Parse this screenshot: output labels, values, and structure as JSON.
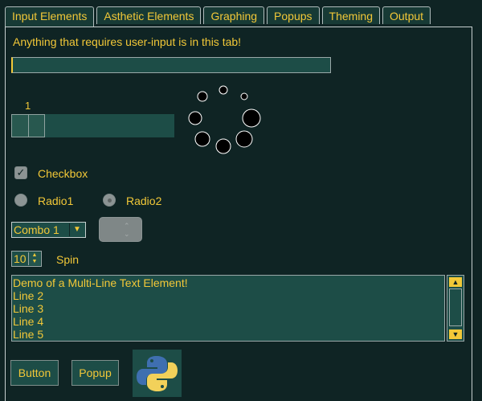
{
  "tabs": [
    "Input Elements",
    "Asthetic Elements",
    "Graphing",
    "Popups",
    "Theming",
    "Output"
  ],
  "active_tab": "Input Elements",
  "caption": "Anything that requires user-input is in this tab!",
  "input": {
    "value": ""
  },
  "slider": {
    "value_label": "1",
    "value": 1
  },
  "spinner": {
    "state": "loading",
    "icon": "loading-spinner-icon"
  },
  "checkbox": {
    "label": "Checkbox",
    "checked": true
  },
  "radios": [
    {
      "label": "Radio1",
      "selected": false
    },
    {
      "label": "Radio2",
      "selected": true
    }
  ],
  "combo": {
    "value": "Combo 1",
    "icon": "chevron-down-icon"
  },
  "combo2": {
    "value": "",
    "icon": "up-down-arrows-icon"
  },
  "spin": {
    "value": "10",
    "label": "Spin"
  },
  "multiline": {
    "lines": [
      "Demo of a Multi-Line Text Element!",
      "Line 2",
      "Line 3",
      "Line 4",
      "Line 5"
    ]
  },
  "buttons": {
    "button_label": "Button",
    "popup_label": "Popup"
  },
  "logo": {
    "icon": "python-logo-icon"
  },
  "colors": {
    "background": "#0f2424",
    "accent_text": "#f2c838",
    "field": "#1d4d47",
    "border": "#c6cfcf"
  }
}
